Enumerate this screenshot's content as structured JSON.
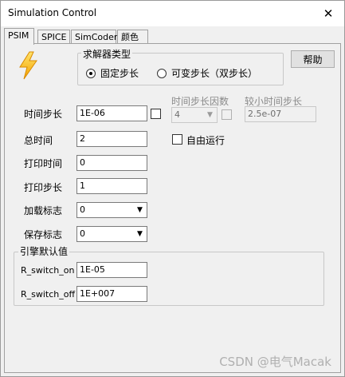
{
  "window": {
    "title": "Simulation Control",
    "close_glyph": "✕"
  },
  "tabs": [
    {
      "label": "PSIM",
      "active": true
    },
    {
      "label": "SPICE",
      "active": false
    },
    {
      "label": "SimCoder",
      "active": false
    },
    {
      "label": "颜色",
      "active": false
    }
  ],
  "solver": {
    "group_title": "求解器类型",
    "option_fixed": "固定步长",
    "option_variable": "可变步长（双步长）",
    "selected": "fixed"
  },
  "help_button": "帮助",
  "fields": {
    "time_step": {
      "label": "时间步长",
      "value": "1E-06"
    },
    "total_time": {
      "label": "总时间",
      "value": "2"
    },
    "print_time": {
      "label": "打印时间",
      "value": "0"
    },
    "print_step": {
      "label": "打印步长",
      "value": "1"
    },
    "load_flag": {
      "label": "加载标志",
      "value": "0"
    },
    "save_flag": {
      "label": "保存标志",
      "value": "0"
    }
  },
  "step_factor": {
    "label": "时间步长因数",
    "value": "4"
  },
  "smaller_step": {
    "label": "较小时间步长",
    "value": "2.5e-07"
  },
  "free_run": {
    "label": "自由运行"
  },
  "engine_defaults": {
    "group_title": "引擎默认值",
    "r_switch_on": {
      "label": "R_switch_on",
      "value": "1E-05"
    },
    "r_switch_off": {
      "label": "R_switch_off",
      "value": "1E+007"
    }
  },
  "icons": {
    "app": "lightning-icon",
    "dropdown": "chevron-down-icon",
    "close": "close-icon"
  },
  "watermark": "CSDN @电气Macak"
}
